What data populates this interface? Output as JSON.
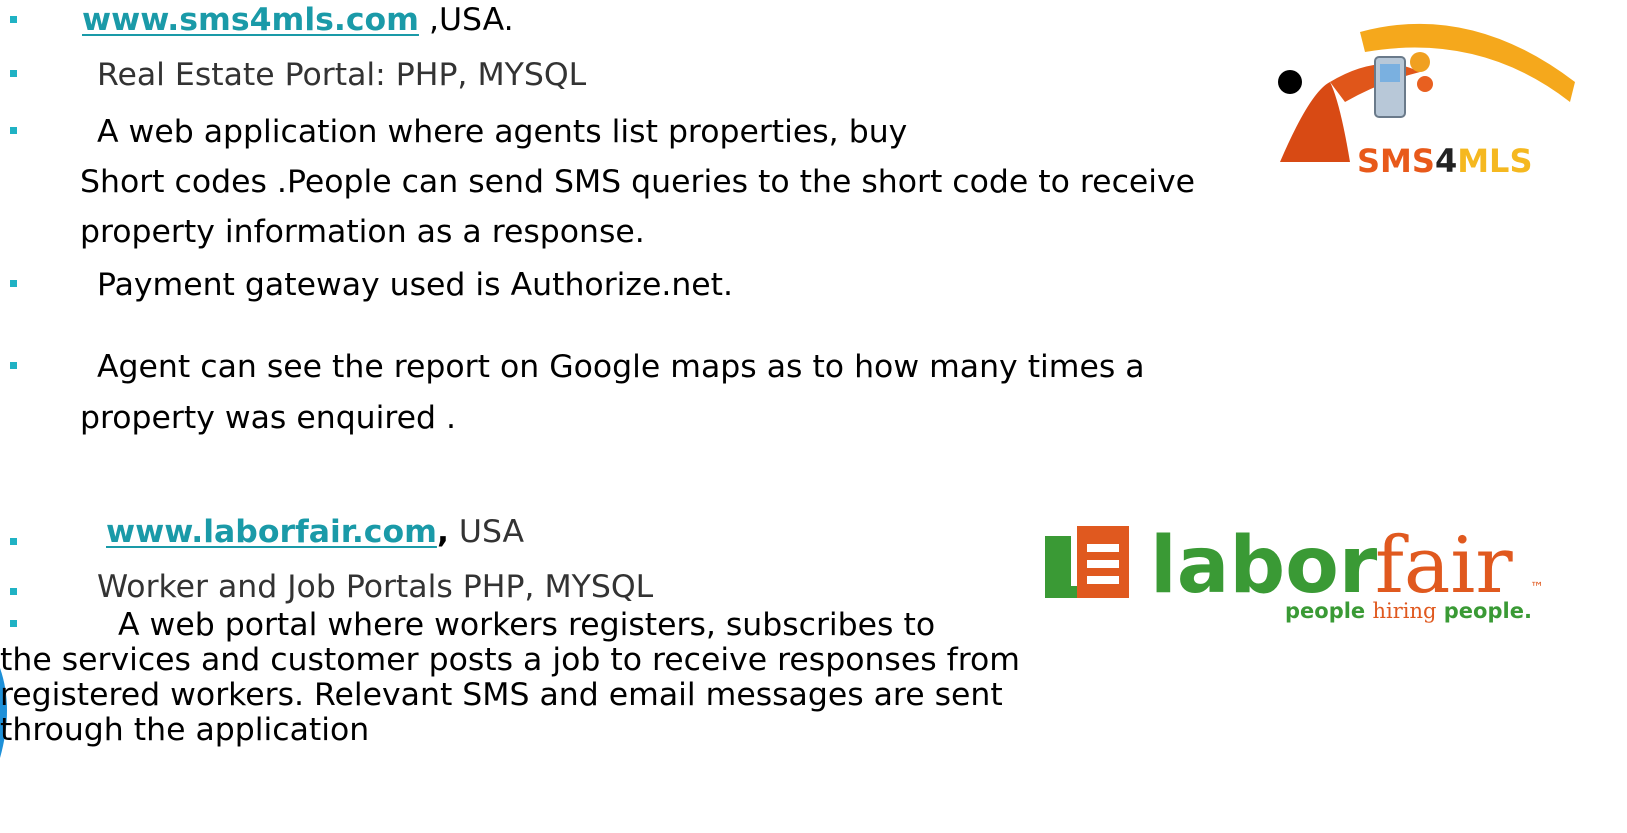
{
  "item1": {
    "link": "www.sms4mls.com",
    "suffix": " ,USA.",
    "tech": "Real Estate Portal: PHP, MYSQL",
    "desc_line1": "A web application where agents list properties, buy",
    "desc_line2": "Short codes .People can send SMS queries to the short code to receive",
    "desc_line3": "property information as a response.",
    "payment": "Payment gateway used is Authorize.net.",
    "report_line1": "Agent can see the report on Google maps as to how many times a",
    "report_line2": "property was enquired ."
  },
  "sms_logo": {
    "text_a": "SMS",
    "text_b": "4",
    "text_c": "MLS"
  },
  "item2": {
    "link": "www.laborfair.com",
    "comma": ",",
    "suffix": " USA",
    "tech": "Worker and Job Portals PHP, MYSQL",
    "desc_line1": "A web portal where workers registers, subscribes to",
    "desc_line2": "the services and customer posts a job to receive responses from",
    "desc_line3": "registered workers. Relevant SMS and email messages are sent",
    "desc_line4": "through the application"
  },
  "labor_logo": {
    "word_a": "labor",
    "word_b": "fair",
    "tm": "™",
    "tag_a": "people ",
    "tag_b": "hiring",
    "tag_c": " people."
  },
  "colors": {
    "bullet": "#20b2c4",
    "link": "#1a9aa8",
    "labor_green": "#3a9a35",
    "labor_orange": "#e0591f",
    "sms_orange": "#f0a020"
  }
}
